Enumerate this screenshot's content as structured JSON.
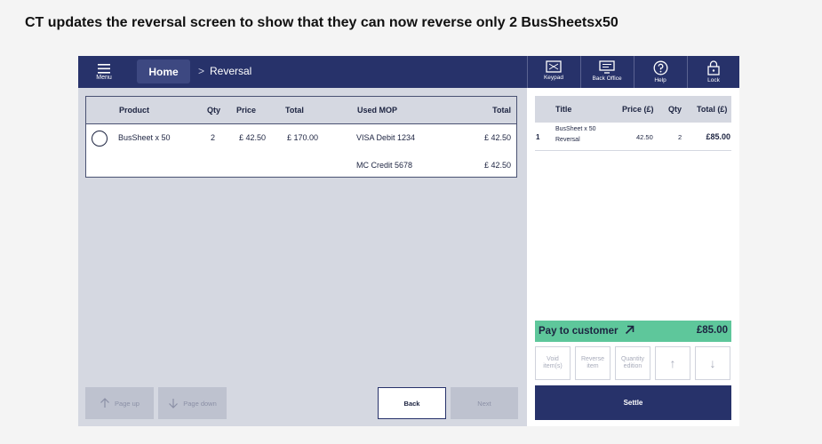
{
  "caption": "CT updates the reversal screen to show that they can now reverse only 2 BusSheetsx50",
  "topbar": {
    "menu_label": "Menu",
    "home_label": "Home",
    "breadcrumb_sep": ">",
    "breadcrumb_current": "Reversal",
    "tools": [
      {
        "label": "Keypad",
        "icon": "keypad-icon"
      },
      {
        "label": "Back Office",
        "icon": "back-office-icon"
      },
      {
        "label": "Help",
        "icon": "help-icon"
      },
      {
        "label": "Lock",
        "icon": "lock-icon"
      }
    ]
  },
  "reversal_table": {
    "headers": {
      "product": "Product",
      "qty": "Qty",
      "price": "Price",
      "total": "Total",
      "used_mop": "Used MOP",
      "mop_total": "Total"
    },
    "row": {
      "product": "BusSheet x 50",
      "qty": "2",
      "price": "£ 42.50",
      "total": "£ 170.00",
      "mop": [
        {
          "name": "VISA Debit 1234",
          "amount": "£ 42.50"
        },
        {
          "name": "MC Credit 5678",
          "amount": "£ 42.50"
        }
      ]
    }
  },
  "bottom_buttons": {
    "page_up": "Page up",
    "page_down": "Page down",
    "back": "Back",
    "next": "Next"
  },
  "basket": {
    "headers": {
      "title": "Title",
      "price": "Price (£)",
      "qty": "Qty",
      "total": "Total (£)"
    },
    "row": {
      "index": "1",
      "title_line1": "BusSheet x 50",
      "title_line2": "Reversal",
      "price": "42.50",
      "qty": "2",
      "total": "£85.00"
    },
    "pay_label": "Pay to customer",
    "pay_amount": "£85.00",
    "actions": {
      "void_l1": "Void",
      "void_l2": "item(s)",
      "reverse_l1": "Reverse",
      "reverse_l2": "item",
      "qty_l1": "Quantity",
      "qty_l2": "edition",
      "up": "↑",
      "down": "↓"
    },
    "settle": "Settle"
  },
  "colors": {
    "navy": "#27326a",
    "panel": "#d5d8e1",
    "pay_green": "#5ec79b",
    "disabled": "#bec2cf"
  }
}
